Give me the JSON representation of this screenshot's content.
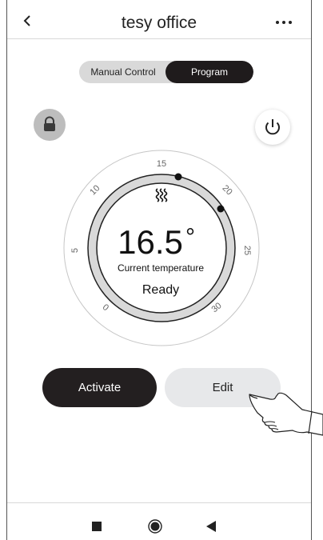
{
  "header": {
    "title": "tesy office",
    "back_icon": "chevron-left-icon",
    "more_icon": "more-horizontal-icon"
  },
  "mode_toggle": {
    "options": [
      "Manual Control",
      "Program"
    ],
    "selected": "Program"
  },
  "lock_icon": "lock-icon",
  "power_icon": "power-icon",
  "dial": {
    "scale_labels": [
      "0",
      "5",
      "10",
      "15",
      "20",
      "25",
      "30"
    ],
    "heat_icon": "heat-waves-icon",
    "temperature": "16.5",
    "unit": "°",
    "temperature_label": "Current temperature",
    "status": "Ready"
  },
  "actions": {
    "activate_label": "Activate",
    "edit_label": "Edit"
  },
  "navigation": {
    "icons": [
      "recents-square-icon",
      "home-circle-icon",
      "back-triangle-icon"
    ]
  },
  "colors": {
    "dark": "#231f20",
    "ring": "#d9d9d9",
    "button_light": "#e7e8ea",
    "lock_bg": "#bdbdbd"
  }
}
